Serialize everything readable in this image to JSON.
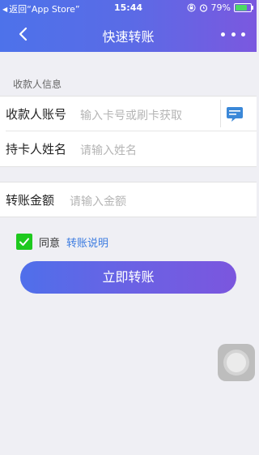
{
  "status_bar": {
    "back_label": "返回“App Store”",
    "time": "15:44",
    "battery_percent": "79%",
    "battery_level": 0.79
  },
  "nav": {
    "title": "快速转账"
  },
  "section": {
    "label": "收款人信息"
  },
  "form": {
    "account": {
      "label": "收款人账号",
      "placeholder": "输入卡号或刷卡获取"
    },
    "name": {
      "label": "持卡人姓名",
      "placeholder": "请输入姓名"
    },
    "amount": {
      "label": "转账金额",
      "placeholder": "请输入金额"
    }
  },
  "agreement": {
    "checked": true,
    "text": "同意",
    "link": "转账说明"
  },
  "submit": {
    "label": "立即转账"
  },
  "colors": {
    "header_start": "#4d72ea",
    "header_end": "#7b58df",
    "checkbox": "#1ec91e",
    "link": "#3b7be0",
    "background": "#efeff4"
  },
  "icons": [
    "back-chevron-icon",
    "more-icon",
    "card-scan-icon",
    "checkmark-icon",
    "alarm-icon",
    "lock-rotation-icon",
    "battery-icon",
    "wifi-icon"
  ]
}
